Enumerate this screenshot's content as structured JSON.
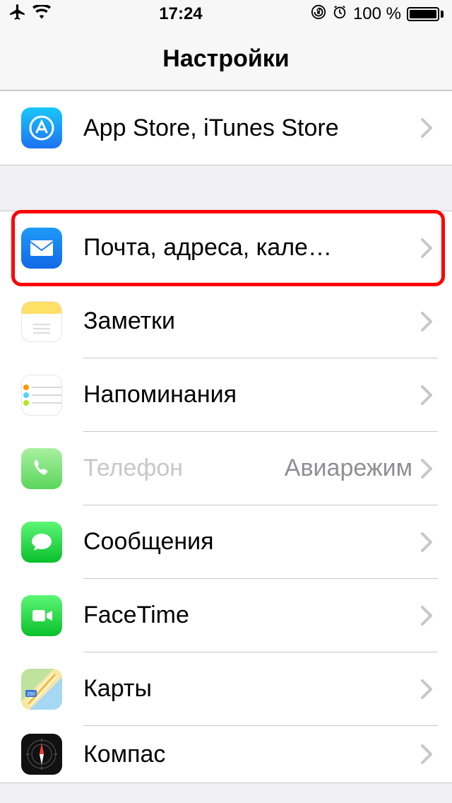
{
  "status": {
    "time": "17:24",
    "battery_text": "100 %"
  },
  "nav": {
    "title": "Настройки"
  },
  "group1": {
    "appstore": {
      "label": "App Store, iTunes Store"
    }
  },
  "group2": {
    "mail": {
      "label": "Почта, адреса, кале…"
    },
    "notes": {
      "label": "Заметки"
    },
    "reminders": {
      "label": "Напоминания"
    },
    "phone": {
      "label": "Телефон",
      "detail": "Авиарежим"
    },
    "messages": {
      "label": "Сообщения"
    },
    "facetime": {
      "label": "FaceTime"
    },
    "maps": {
      "label": "Карты"
    },
    "compass": {
      "label": "Компас"
    }
  }
}
